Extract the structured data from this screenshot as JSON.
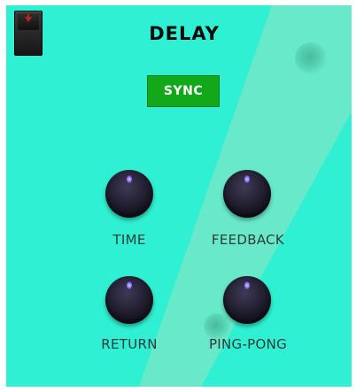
{
  "plugin": {
    "title": "DELAY",
    "sync_label": "SYNC",
    "power_icon": "power-switch-icon",
    "colors": {
      "panel": "#2ff0d2",
      "stripe": "#6fe8c9",
      "sync_button": "#12a81a",
      "knob": "#1c1a2a",
      "label": "#2f3b38"
    }
  },
  "knobs": [
    {
      "label": "TIME"
    },
    {
      "label": "FEEDBACK"
    },
    {
      "label": "RETURN"
    },
    {
      "label": "PING-PONG"
    }
  ]
}
